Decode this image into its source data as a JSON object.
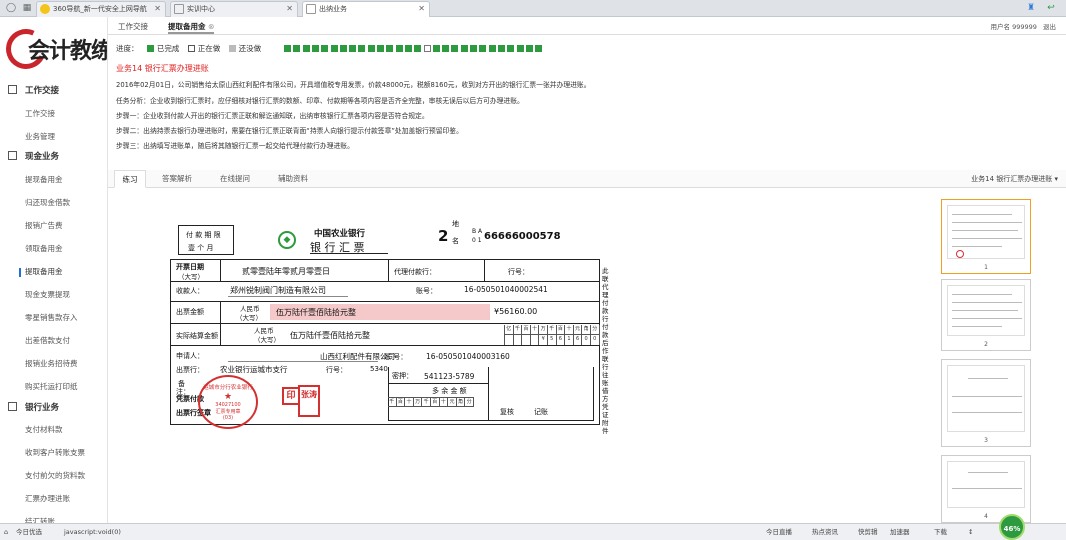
{
  "browser": {
    "tabs": [
      {
        "label": "360导航_新一代安全上网导航",
        "close": "✕"
      },
      {
        "label": "实训中心",
        "close": "✕"
      },
      {
        "label": "出纳业务",
        "close": "✕"
      }
    ]
  },
  "sidebar": {
    "logo_text": "会计教练",
    "sections": [
      {
        "title": "工作交接",
        "items": [
          "工作交接",
          "业务管理"
        ]
      },
      {
        "title": "现金业务",
        "items": [
          "提现备用金",
          "归还现金借款",
          "报销广告费",
          "领取备用金",
          "提取备用金",
          "现金支票提现",
          "零星销售款存入",
          "出差借款支付",
          "报销业务招待费",
          "购买托运打印纸"
        ]
      },
      {
        "title": "银行业务",
        "items": [
          "支付材料款",
          "收到客户转账支票",
          "支付前欠的货料款",
          "汇票办理进账",
          "结汇转账"
        ]
      }
    ]
  },
  "page_tabs": [
    "工作交接",
    "提取备用金"
  ],
  "user_info": {
    "label": "用户名",
    "id": "999999",
    "logout": "退出"
  },
  "progress": {
    "label": "进度：",
    "legend": [
      "已完成",
      "正在做",
      "还没做"
    ],
    "colors": {
      "done": "#2e9a3f",
      "doing": "#ffffff",
      "todo": "#bbbbbb"
    },
    "done_count": 15,
    "current_index": 15,
    "total": 28
  },
  "task": {
    "title": "业务14  银行汇票办理进账",
    "lines": [
      "2016年02月01日，公司销售给太原山西红利配件有限公司，开具增值税专用发票，价款48000元，税额8160元，收到对方开出的银行汇票一张并办理进账。",
      "任务分析：企业收到银行汇票时，应仔细核对银行汇票的数额、印章、付款期等各项内容是否齐全完整，审核无误后以后方可办理进账。",
      "步骤一：企业收到付款人开出的银行汇票正联和解讫通知联，出纳审核银行汇票各项内容是否符合规定。",
      "步骤二：出纳持票去银行办理进账时，需要在银行汇票正联背面“持票人向银行提示付款签章”处加盖银行预留印鉴。",
      "步骤三：出纳填写进账单，随后将其随银行汇票一起交给代理付款行办理进账。"
    ]
  },
  "work_tabs": [
    "练习",
    "答案解析",
    "在线提问",
    "辅助资料"
  ],
  "work_tab_right": "业务14 银行汇票办理进账",
  "form": {
    "pay_period_1": "付 款 期 限",
    "pay_period_2": "壹 个 月",
    "bank_name": "中国农业银行",
    "doc_title": "银 行 汇 票",
    "digit": "2",
    "di": "地",
    "ming": "名",
    "ba": "B A",
    "ba2": "0 1",
    "serial": "66666000578",
    "issue_date_label": "开票日期",
    "issue_date_sub": "（大写）",
    "issue_date": "贰零壹陆年零贰月零壹日",
    "agent_bank_label": "代理付款行：",
    "bank_no_label": "行号：",
    "payee_label": "收款人：",
    "payee": "郑州锐制阀门制造有限公司",
    "account_label": "账号：",
    "payee_account": "16-050501040002541",
    "amount_label": "出票金额",
    "rmb_label": "人民币",
    "rmb_sub": "（大写）",
    "amount_text": "伍万陆仟壹佰陆拾元整",
    "amount_num": "¥56160.00",
    "settle_label": "实际结算金额",
    "settle_text": "伍万陆仟壹佰陆拾元整",
    "digit_headers": [
      "亿",
      "千",
      "百",
      "十",
      "万",
      "千",
      "百",
      "十",
      "元",
      "角",
      "分"
    ],
    "settle_digits": [
      "",
      "",
      "",
      "",
      "¥",
      "5",
      "6",
      "1",
      "6",
      "0",
      "0"
    ],
    "applicant_label": "申请人：",
    "applicant": "山西红利配件有限公司",
    "applicant_account_label": "账  号：",
    "applicant_account": "16-050501040003160",
    "issuing_bank_label": "出票行：",
    "issuing_bank": "农业银行运城市支行",
    "issuing_bank_no_label": "行号：",
    "issuing_bank_no": "5340",
    "remark_label": "备",
    "remark2": "注：",
    "paid_label": "凭票付款",
    "stamp_label": "出票行签章",
    "password_label": "密押：",
    "password": "541123-5789",
    "balance_label": "多  余  金  额",
    "balance_headers": [
      "千",
      "百",
      "十",
      "万",
      "千",
      "百",
      "十",
      "元",
      "角",
      "分"
    ],
    "review_label": "复核",
    "record_label": "记账",
    "side_text": "此联代理付款行付款后作联行往账借方凭证附件",
    "seal_text": "运城市分行农业银行",
    "seal_sub1": "汇票专用章",
    "seal_sub2": "(03)",
    "seal_sub3": "34027100",
    "stamp_chars": [
      "印",
      "张涛"
    ]
  },
  "thumbnails": [
    "1",
    "2",
    "3",
    "4"
  ],
  "status_bar": {
    "left": "今日优选",
    "url": "javascript:void(0)",
    "items": [
      "今日直播",
      "热点资讯",
      "快剪辑",
      "加速器",
      "下载",
      "↕"
    ],
    "badge": "46%"
  }
}
